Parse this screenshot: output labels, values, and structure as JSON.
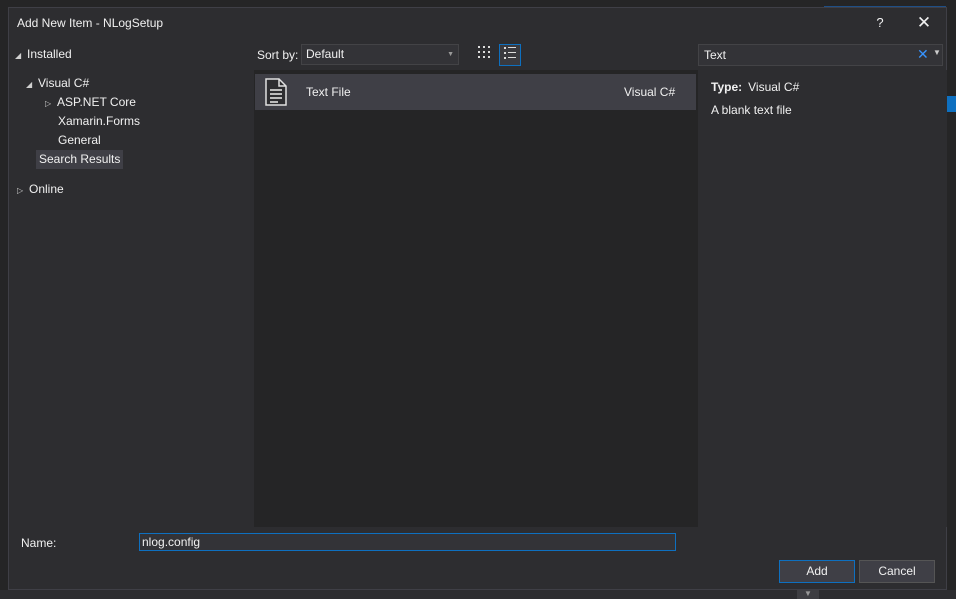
{
  "window": {
    "title": "Add New Item - NLogSetup",
    "help": "?",
    "close": "✕"
  },
  "tree": {
    "installed": "Installed",
    "visual_csharp": "Visual C#",
    "aspnet_core": "ASP.NET Core",
    "xamarin_forms": "Xamarin.Forms",
    "general": "General",
    "search_results": "Search Results",
    "online": "Online"
  },
  "sort": {
    "label": "Sort by:",
    "value": "Default"
  },
  "list": {
    "items": [
      {
        "name": "Text File",
        "language": "Visual C#",
        "icon": "text-file-icon"
      }
    ]
  },
  "search": {
    "value": "Text"
  },
  "details": {
    "type_label": "Type:",
    "type_value": "Visual C#",
    "description": "A blank text file"
  },
  "name_field": {
    "label": "Name:",
    "value": "nlog.config"
  },
  "buttons": {
    "add": "Add",
    "cancel": "Cancel"
  },
  "colors": {
    "accent": "#0e70c0",
    "background": "#2d2d30",
    "panel": "#252526",
    "selection": "#3f3f46"
  }
}
